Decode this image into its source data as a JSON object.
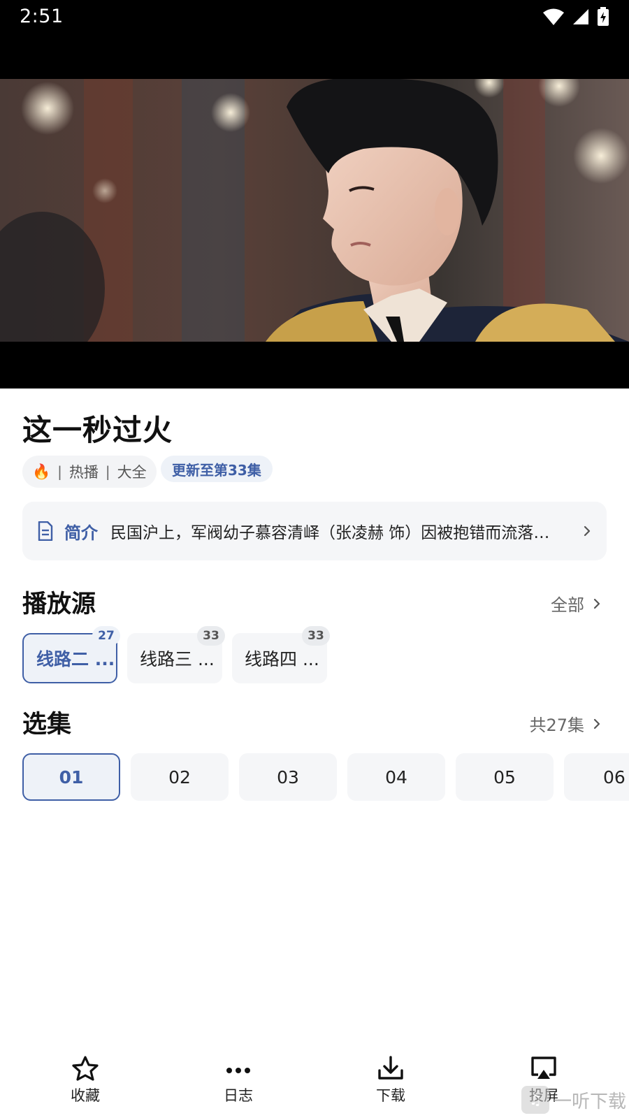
{
  "status_bar": {
    "time": "2:51"
  },
  "video": {
    "alt": "video frame"
  },
  "drama": {
    "title": "这一秒过火",
    "meta": {
      "fire": "🔥",
      "hot": "热播",
      "sep": "|",
      "category": "大全"
    },
    "update": "更新至第33集"
  },
  "synopsis": {
    "label": "简介",
    "text": "民国沪上，军阀幼子慕容清峄（张凌赫 饰）因被抱错而流落在外，后被接回府中……"
  },
  "sources": {
    "title": "播放源",
    "more": "全部",
    "items": [
      {
        "label": "线路二 ...",
        "count": "27"
      },
      {
        "label": "线路三 ...",
        "count": "33"
      },
      {
        "label": "线路四 ...",
        "count": "33"
      }
    ]
  },
  "episodes": {
    "title": "选集",
    "total": "共27集",
    "items": [
      "01",
      "02",
      "03",
      "04",
      "05",
      "06"
    ]
  },
  "bottom_nav": {
    "favorite": "收藏",
    "log": "日志",
    "download": "下载",
    "cast": "投屏"
  },
  "watermark": {
    "text": "一听下载"
  },
  "colors": {
    "accent": "#3f5fa6",
    "chip_bg": "#f5f6f8",
    "active_bg": "#eef2f8"
  }
}
